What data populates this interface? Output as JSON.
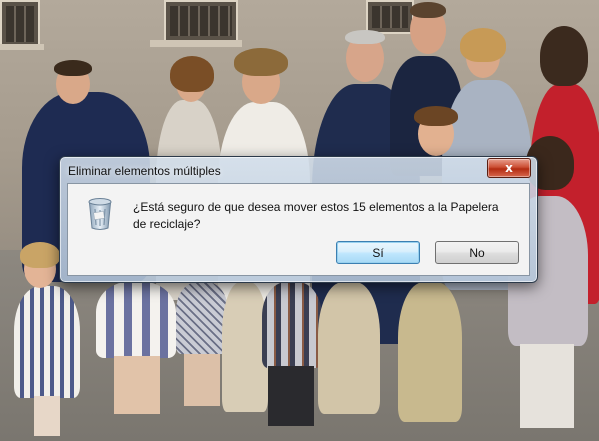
{
  "dialog": {
    "title": "Eliminar elementos múltiples",
    "close_label": "x",
    "message": "¿Está seguro de que desea mover estos 15 elementos a la Papelera de reciclaje?",
    "icon": "recycle-bin-icon",
    "buttons": {
      "yes": "Sí",
      "no": "No"
    }
  },
  "background": {
    "description_icon": "family-photo",
    "accent_colors": [
      "#1c2a4a",
      "#c21e2b",
      "#e8e6e2",
      "#8a9bb5"
    ]
  }
}
